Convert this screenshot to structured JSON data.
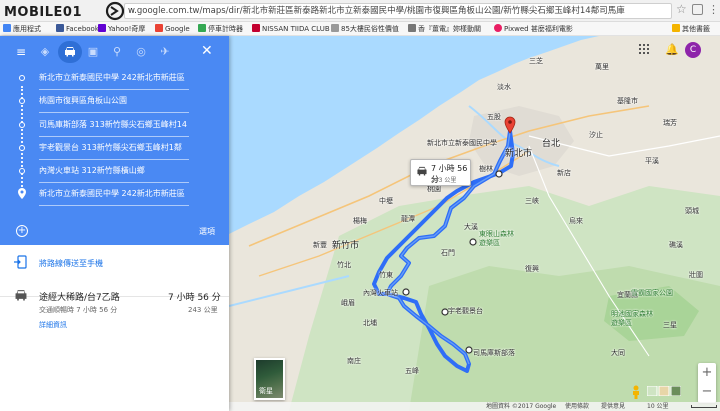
{
  "browser": {
    "logo_text": "MOBILE01",
    "url_scheme": "w.",
    "url": "google.com.tw/maps/dir/新北市新莊區新泰路新北市立新泰國民中學/桃園市復興區角板山公園/新竹縣尖石鄉玉峰村14鄰司馬庫",
    "bookmarks": [
      {
        "label": "應用程式",
        "color": "#4285f4"
      },
      {
        "label": "Facebook",
        "color": "#3b5998"
      },
      {
        "label": "Yahoo!奇摩",
        "color": "#6001d2"
      },
      {
        "label": "Google",
        "color": "#ea4335"
      },
      {
        "label": "停車計時器",
        "color": "#34a853"
      },
      {
        "label": "NISSAN TIIDA CLUB",
        "color": "#c3002f"
      },
      {
        "label": "85大樓民俗性價值",
        "color": "#999999"
      },
      {
        "label": "香『薑電』妳樣動關",
        "color": "#777777"
      },
      {
        "label": "Pixwed 甚麼福利電影",
        "color": "#e91e63"
      },
      {
        "label": "其他書籤",
        "color": "#f4b400"
      }
    ]
  },
  "directions": {
    "stops": [
      "新北市立新泰國民中學 242新北市新莊區",
      "桃園市復興區角板山公園",
      "司馬庫斯部落 313新竹縣尖石鄉玉峰村14",
      "宇老觀景台 313新竹縣尖石鄉玉峰村1鄰",
      "內灣火車站 312新竹縣橫山鄉",
      "新北市立新泰國民中學 242新北市新莊區"
    ],
    "options_label": "選項",
    "send_label": "將路線傳送至手機",
    "route": {
      "name": "途經大稀路/台7乙路",
      "time": "7 小時 56 分",
      "sub": "交通順暢時 7 小時 56 分",
      "distance": "243 公里",
      "details_label": "詳細資訊"
    }
  },
  "map": {
    "time_box": {
      "time": "7 小時 56 分",
      "distance": "243 公里"
    },
    "avatar_letter": "C",
    "satellite_label": "衛星",
    "labels": {
      "taipei": "台北",
      "xinbei": "新北市",
      "keelung": "基隆市",
      "hsinchu": "新竹市",
      "school": "新北市立新泰國民中學",
      "park": "東眼山森林遊樂區",
      "neiwan": "內灣火車站",
      "yulao": "宇老觀景台",
      "smangus": "司馬庫斯部落",
      "mingchi": "明池國家森林遊樂區",
      "yilan": "宜蘭縣",
      "nshp": "雪霸國家公園",
      "ks1": "三峽",
      "ks2": "大溪",
      "ks3": "龍潭",
      "ks4": "石門",
      "ks5": "平溪",
      "ks6": "烏來",
      "ks7": "新店",
      "ks8": "樹林",
      "ks9": "五股",
      "ks10": "汐止",
      "ks11": "瑞芳",
      "ks12": "三芝",
      "ks13": "萬里",
      "ks14": "淡水",
      "ks15": "桃園",
      "ks16": "中壢",
      "ks17": "楊梅",
      "ks18": "新豐",
      "ks19": "竹北",
      "ks20": "竹東",
      "ks21": "峨眉",
      "ks22": "北埔",
      "ks23": "五峰",
      "ks24": "南庄",
      "ks25": "復興",
      "ks26": "大同",
      "ks27": "頭城",
      "ks28": "礁溪",
      "ks29": "壯圍",
      "ks30": "三星"
    },
    "footer": {
      "copyright": "地圖資料 ©2017 Google",
      "terms": "使用條款",
      "feedback": "提供意見",
      "scale": "10 公里"
    }
  }
}
